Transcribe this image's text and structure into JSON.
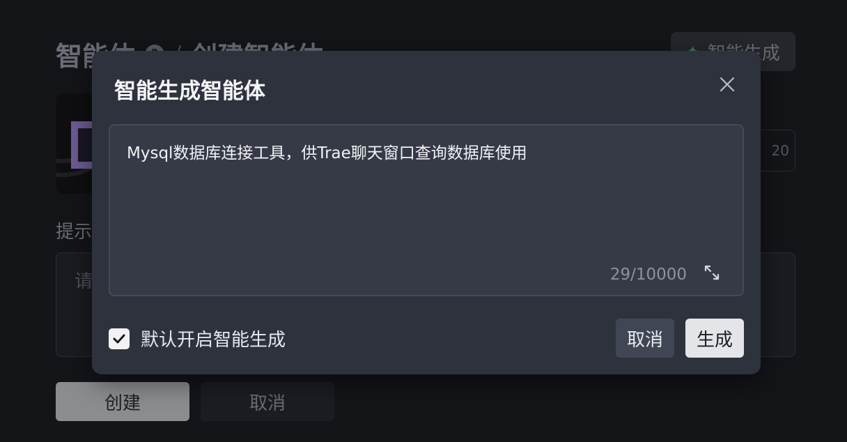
{
  "background": {
    "title": "智能体",
    "help_icon_glyph": "?",
    "separator": "/",
    "subtitle": "创建智能体",
    "gen_button_label": "智能生成",
    "name_counter": "20",
    "prompt_label": "提示",
    "prompt_placeholder": "请",
    "create_button_label": "创建",
    "cancel_button_label": "取消"
  },
  "modal": {
    "title": "智能生成智能体",
    "textarea_value": "Mysql数据库连接工具，供Trae聊天窗口查询数据库使用",
    "char_count": "29/10000",
    "checkbox_label": "默认开启智能生成",
    "checkbox_checked": true,
    "cancel_label": "取消",
    "generate_label": "生成"
  },
  "colors": {
    "page_bg": "#141519",
    "modal_bg": "#2e323d",
    "textarea_bg": "#363a46",
    "primary_button_bg": "#e4e5e9",
    "secondary_button_bg": "#414655"
  },
  "icons": {
    "help": "help-circle-icon",
    "sparkle": "sparkle-icon",
    "close": "close-icon",
    "expand": "expand-icon",
    "check": "check-icon"
  }
}
